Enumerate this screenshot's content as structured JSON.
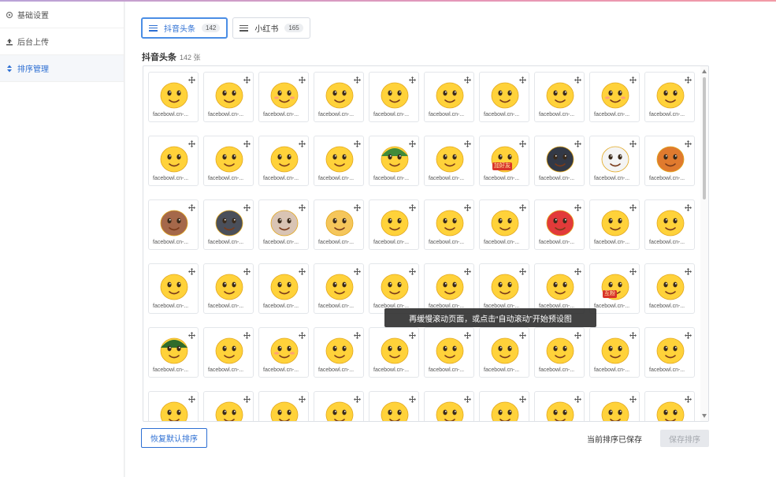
{
  "sidebar": {
    "items": [
      {
        "label": "基础设置",
        "icon": "gear-icon"
      },
      {
        "label": "后台上传",
        "icon": "upload-icon"
      },
      {
        "label": "排序管理",
        "icon": "sort-icon",
        "active": true
      }
    ]
  },
  "tabs": [
    {
      "label": "抖音头条",
      "count": "142",
      "active": true
    },
    {
      "label": "小红书",
      "count": "165"
    }
  ],
  "section": {
    "title": "抖音头条",
    "count": "142 张"
  },
  "grid": {
    "caption": "facebowl.cn-...",
    "items": [
      {
        "emoji": "rainbow-vomit"
      },
      {
        "emoji": "star-eyes"
      },
      {
        "emoji": "kiss"
      },
      {
        "emoji": "sleepy"
      },
      {
        "emoji": "angry-fist"
      },
      {
        "emoji": "wink-laugh"
      },
      {
        "emoji": "smile"
      },
      {
        "emoji": "surprised"
      },
      {
        "emoji": "blush"
      },
      {
        "emoji": "grin-sweat"
      },
      {
        "emoji": "cool-sweat"
      },
      {
        "emoji": "facepalm"
      },
      {
        "emoji": "watermelon"
      },
      {
        "emoji": "big-grin"
      },
      {
        "emoji": "green-hat"
      },
      {
        "emoji": "sweat"
      },
      {
        "emoji": "add-friend",
        "badge": "加好友"
      },
      {
        "emoji": "black-ball"
      },
      {
        "emoji": "skull"
      },
      {
        "emoji": "bear"
      },
      {
        "emoji": "dog-brown"
      },
      {
        "emoji": "husky"
      },
      {
        "emoji": "cat"
      },
      {
        "emoji": "shiba"
      },
      {
        "emoji": "stare"
      },
      {
        "emoji": "big-lips"
      },
      {
        "emoji": "headphones"
      },
      {
        "emoji": "rage"
      },
      {
        "emoji": "wow"
      },
      {
        "emoji": "peek"
      },
      {
        "emoji": "phone-call"
      },
      {
        "emoji": "smirk-hand"
      },
      {
        "emoji": "kiss-heart"
      },
      {
        "emoji": "heart-eyes"
      },
      {
        "emoji": "plead"
      },
      {
        "emoji": "cover-face"
      },
      {
        "emoji": "glance"
      },
      {
        "emoji": "crying"
      },
      {
        "emoji": "follow",
        "badge": "互粉"
      },
      {
        "emoji": "roll-eyes"
      },
      {
        "emoji": "army-helmet"
      },
      {
        "emoji": "happy"
      },
      {
        "emoji": "shy"
      },
      {
        "emoji": "teary"
      },
      {
        "emoji": "whistle"
      },
      {
        "emoji": "scream"
      },
      {
        "emoji": "dizzy"
      },
      {
        "emoji": "tears-joy"
      },
      {
        "emoji": "laugh-cry"
      },
      {
        "emoji": "sunglasses"
      },
      {
        "emoji": "oops"
      },
      {
        "emoji": "teeth"
      },
      {
        "emoji": "lol"
      },
      {
        "emoji": "meh"
      },
      {
        "emoji": "smug"
      },
      {
        "emoji": "sweat-laugh"
      },
      {
        "emoji": "cheer"
      },
      {
        "emoji": "side-eye"
      },
      {
        "emoji": "dazed"
      },
      {
        "emoji": "glasses"
      }
    ]
  },
  "toast": "再缓慢滚动页面，或点击“自动滚动”开始预设图",
  "footer": {
    "reset_label": "恢复默认排序",
    "status": "当前排序已保存",
    "save_label": "保存排序"
  },
  "colors": {
    "accent": "#2d6fd3",
    "emoji_yellow": "#ffd23a"
  }
}
